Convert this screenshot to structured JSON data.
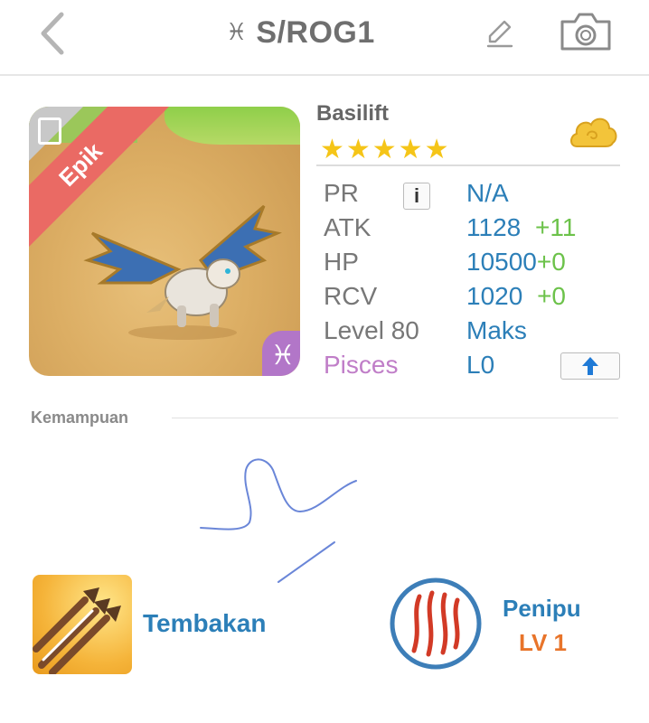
{
  "header": {
    "zodiac_symbol": "♓",
    "title": "S/ROG1",
    "back_icon": "chevron-left-icon",
    "edit_icon": "pencil-icon",
    "camera_icon": "camera-icon"
  },
  "card": {
    "rarity": "Epik",
    "zodiac_symbol": "♓",
    "name": "Basilift",
    "stars": "★★★★★",
    "star_count": 5
  },
  "stats": [
    {
      "label": "PR",
      "value": "N/A",
      "bonus": ""
    },
    {
      "label": "ATK",
      "value": "1128",
      "bonus": "+11"
    },
    {
      "label": "HP",
      "value": "10500",
      "bonus": "+0"
    },
    {
      "label": "RCV",
      "value": "1020",
      "bonus": "+0"
    },
    {
      "label": "Level 80",
      "value": "Maks",
      "bonus": ""
    },
    {
      "label": "Pisces",
      "value": "L0",
      "bonus": ""
    }
  ],
  "abilities": {
    "section_title": "Kemampuan",
    "skill_name": "Tembakan",
    "leader_name": "Penipu",
    "leader_level": "LV 1"
  },
  "colors": {
    "accent_blue": "#2c7fb8",
    "bonus_green": "#6cc24a",
    "pisces_purple": "#b276c8",
    "epic_red": "#ea6a64",
    "level_orange": "#e8742a"
  }
}
